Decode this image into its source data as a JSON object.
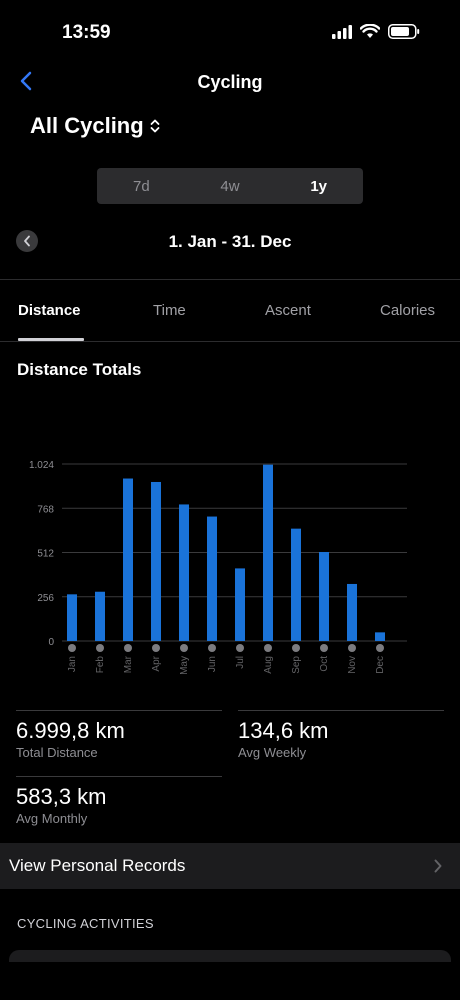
{
  "status": {
    "time": "13:59"
  },
  "nav": {
    "title": "Cycling",
    "back_icon": "chevron-left-icon"
  },
  "selector": {
    "label": "All Cycling",
    "icon": "chevron-up-down-icon"
  },
  "period_segments": [
    {
      "label": "7d",
      "active": false
    },
    {
      "label": "4w",
      "active": false
    },
    {
      "label": "1y",
      "active": true
    }
  ],
  "date_range": "1. Jan - 31. Dec",
  "tabs": [
    {
      "label": "Distance",
      "active": true
    },
    {
      "label": "Time",
      "active": false
    },
    {
      "label": "Ascent",
      "active": false
    },
    {
      "label": "Calories",
      "active": false
    }
  ],
  "section_title": "Distance Totals",
  "chart_data": {
    "type": "bar",
    "categories": [
      "Jan",
      "Feb",
      "Mar",
      "Apr",
      "May",
      "Jun",
      "Jul",
      "Aug",
      "Sep",
      "Oct",
      "Nov",
      "Dec"
    ],
    "values": [
      270,
      285,
      940,
      920,
      790,
      720,
      420,
      1020,
      650,
      515,
      330,
      50
    ],
    "y_ticks": [
      "0",
      "256",
      "512",
      "768",
      "1.024"
    ],
    "y_tick_values": [
      0,
      256,
      512,
      768,
      1024
    ],
    "ylim": [
      0,
      1024
    ],
    "grid": true,
    "bar_color": "#1a73d9"
  },
  "stats": {
    "total_distance": {
      "value": "6.999,8 km",
      "label": "Total Distance"
    },
    "avg_weekly": {
      "value": "134,6 km",
      "label": "Avg Weekly"
    },
    "avg_monthly": {
      "value": "583,3 km",
      "label": "Avg Monthly"
    }
  },
  "records_label": "View Personal Records",
  "activities_header": "CYCLING ACTIVITIES",
  "colors": {
    "accent": "#1a73d9",
    "link": "#3478f6"
  }
}
